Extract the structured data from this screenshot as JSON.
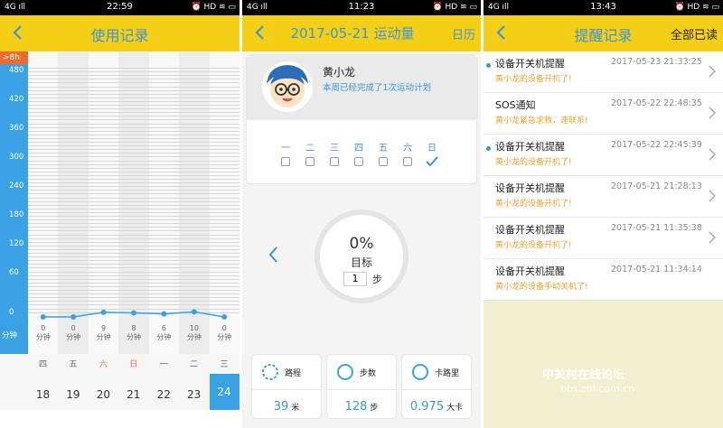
{
  "panel1": {
    "status": {
      "left": "4G ıll",
      "time": "22:59",
      "right": "⏰ HD ≋ ▭"
    },
    "title": "使用记录",
    "y_top_label": ">8h",
    "y_ticks": [
      "480",
      "420",
      "360",
      "300",
      "240",
      "180",
      "120",
      "60",
      "0"
    ],
    "y_unit": "分钟",
    "columns": [
      {
        "value": "0",
        "unit": "分钟",
        "weekday": "四",
        "date": "18"
      },
      {
        "value": "0",
        "unit": "分钟",
        "weekday": "五",
        "date": "19"
      },
      {
        "value": "9",
        "unit": "分钟",
        "weekday": "六",
        "date": "20"
      },
      {
        "value": "8",
        "unit": "分钟",
        "weekday": "日",
        "date": "21"
      },
      {
        "value": "6",
        "unit": "分钟",
        "weekday": "一",
        "date": "22"
      },
      {
        "value": "10",
        "unit": "分钟",
        "weekday": "二",
        "date": "23"
      },
      {
        "value": "0",
        "unit": "分钟",
        "weekday": "三",
        "date": "24"
      }
    ],
    "colors": {
      "accent": "#3aa2e4",
      "weekend": "#f26a2a",
      "header": "#f5cf16"
    }
  },
  "panel2": {
    "status": {
      "left": "4G ıll",
      "time": "11:23",
      "right": "⏰ HD ≋ ▭"
    },
    "title": "2017-05-21 运动量",
    "calendar_label": "日历",
    "user_name": "黄小龙",
    "plan_text": "本周已经完成了1次运动计划",
    "weekdays": [
      "一",
      "二",
      "三",
      "四",
      "五",
      "六",
      "日"
    ],
    "percent": "0%",
    "goal_label": "目标",
    "goal_value": "1",
    "goal_unit": "步",
    "stats": [
      {
        "label": "路程",
        "value": "39",
        "unit": "米"
      },
      {
        "label": "步数",
        "value": "128",
        "unit": "步"
      },
      {
        "label": "卡路里",
        "value": "0.975",
        "unit": "大卡"
      }
    ]
  },
  "panel3": {
    "status": {
      "left": "4G ıll",
      "time": "13:43",
      "right": "⏰ HD ≋ ▭"
    },
    "title": "提醒记录",
    "mark_all": "全部已读",
    "items": [
      {
        "title": "设备开关机提醒",
        "sub": "黄小龙的设备开机了!",
        "date": "2017-05-23 21:33:25"
      },
      {
        "title": "SOS通知",
        "sub": "黄小龙紧急求救，速联系!",
        "date": "2017-05-22 22:48:35"
      },
      {
        "title": "设备开关机提醒",
        "sub": "黄小龙的设备开机了!",
        "date": "2017-05-22 22:45:39"
      },
      {
        "title": "设备开关机提醒",
        "sub": "黄小龙的设备开机了!",
        "date": "2017-05-21 21:28:13"
      },
      {
        "title": "设备开关机提醒",
        "sub": "黄小龙的设备开机了!",
        "date": "2017-05-21 11:35:38"
      },
      {
        "title": "设备开关机提醒",
        "sub": "黄小龙的设备手动关机了!",
        "date": "2017-05-21 11:34:14"
      }
    ]
  },
  "watermark": {
    "line1": "中关村在线论坛",
    "line2": "bbs.zol.com.cn"
  }
}
